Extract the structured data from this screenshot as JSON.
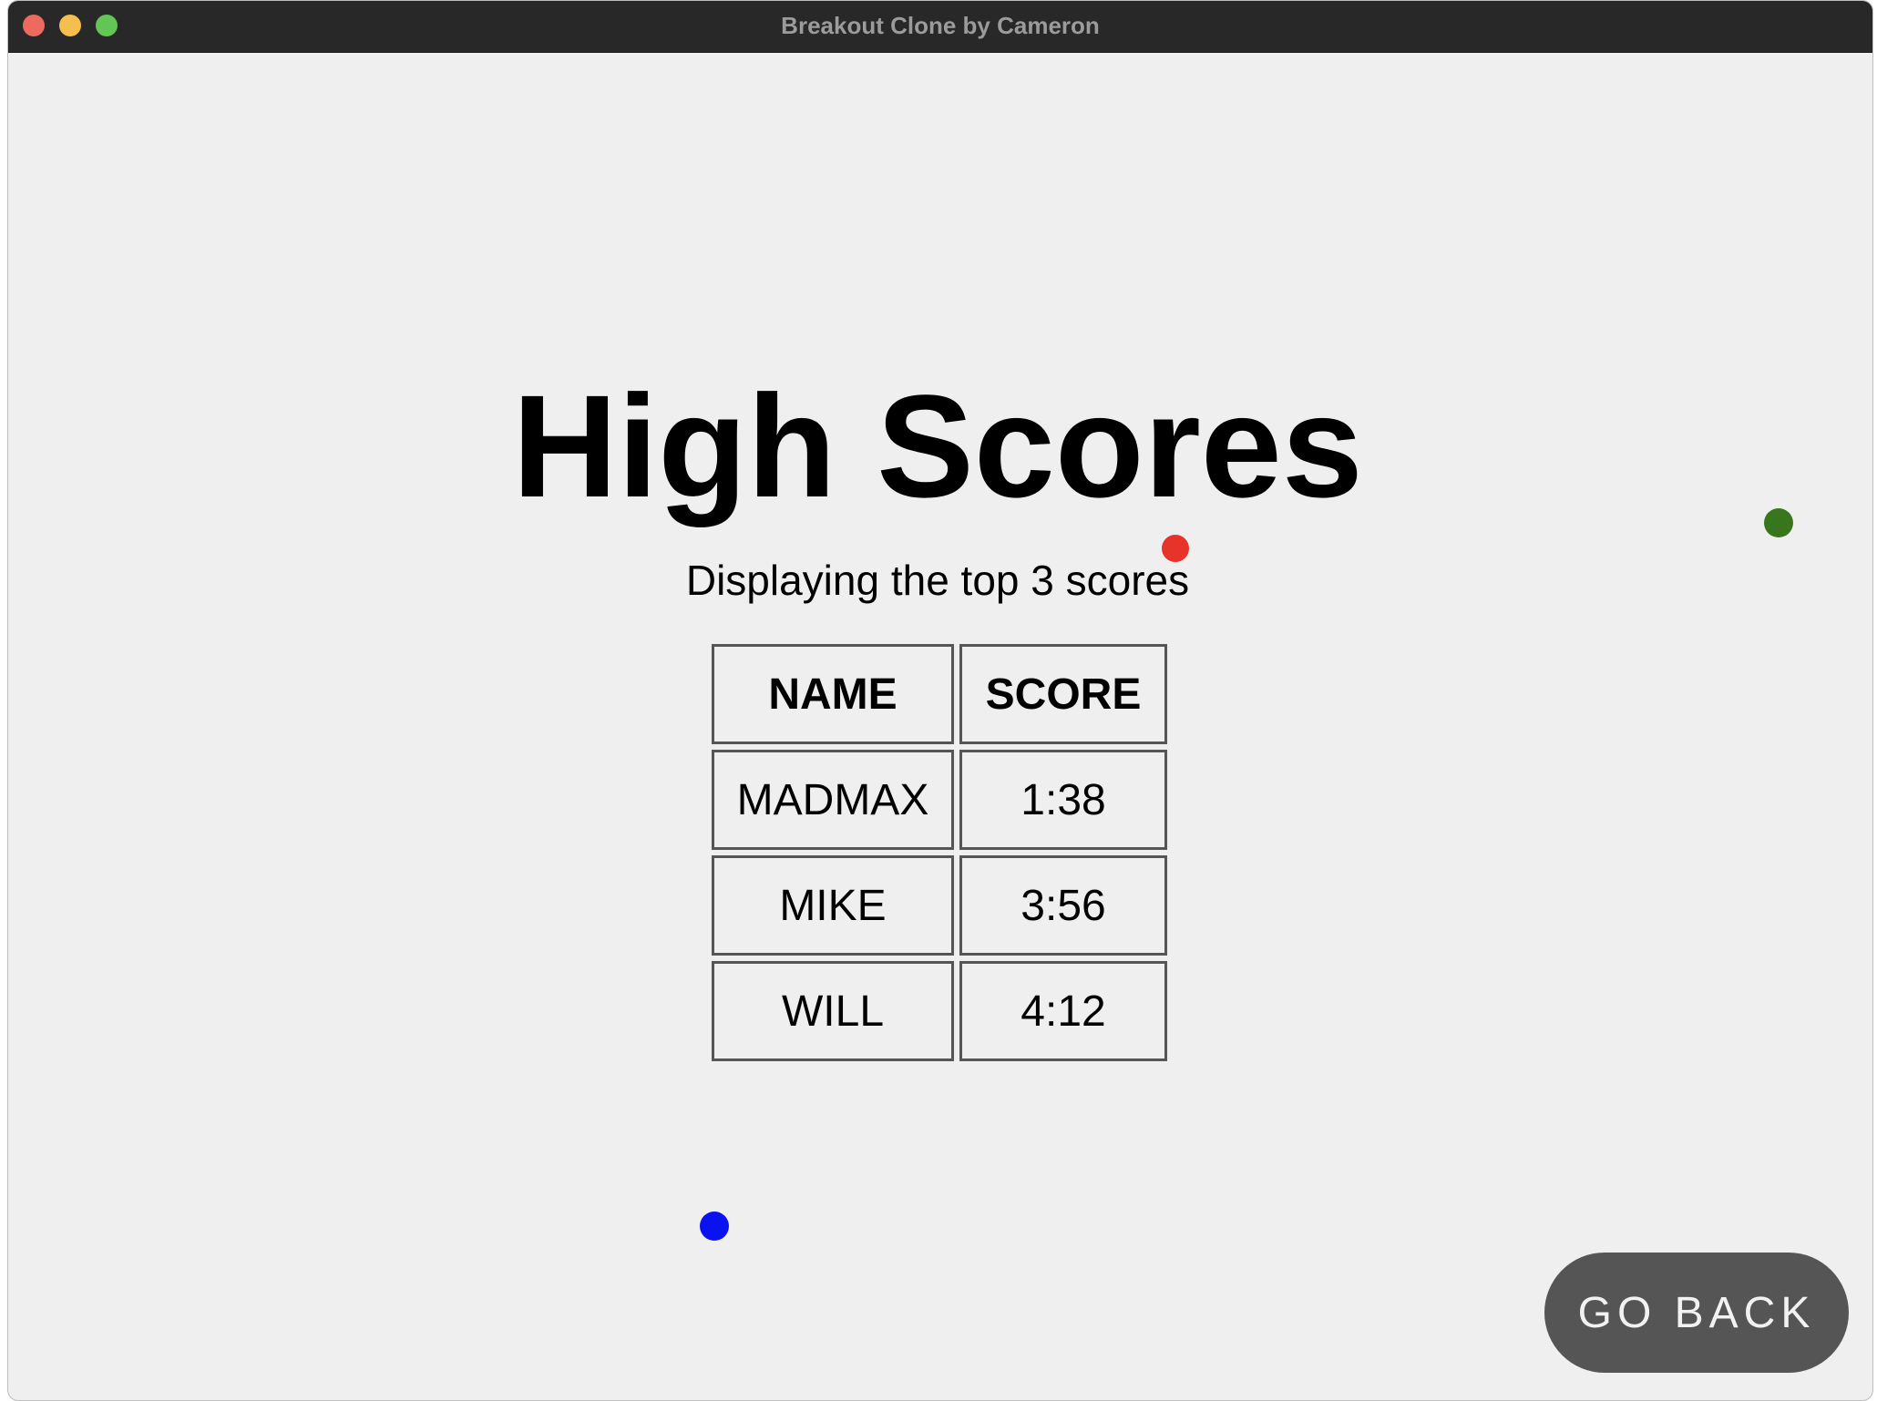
{
  "window": {
    "title": "Breakout Clone by Cameron"
  },
  "page": {
    "heading": "High Scores",
    "subtitle": "Displaying the top 3 scores"
  },
  "scores_table": {
    "headers": [
      "NAME",
      "SCORE"
    ],
    "rows": [
      [
        "MADMAX",
        "1:38"
      ],
      [
        "MIKE",
        "3:56"
      ],
      [
        "WILL",
        "4:12"
      ]
    ]
  },
  "buttons": {
    "go_back": "GO BACK"
  },
  "colors": {
    "background": "#efefef",
    "titlebar": "#282828",
    "button": "#555555",
    "ball_red": "#e8332a",
    "ball_green": "#38761d",
    "ball_blue": "#0a12f0"
  }
}
